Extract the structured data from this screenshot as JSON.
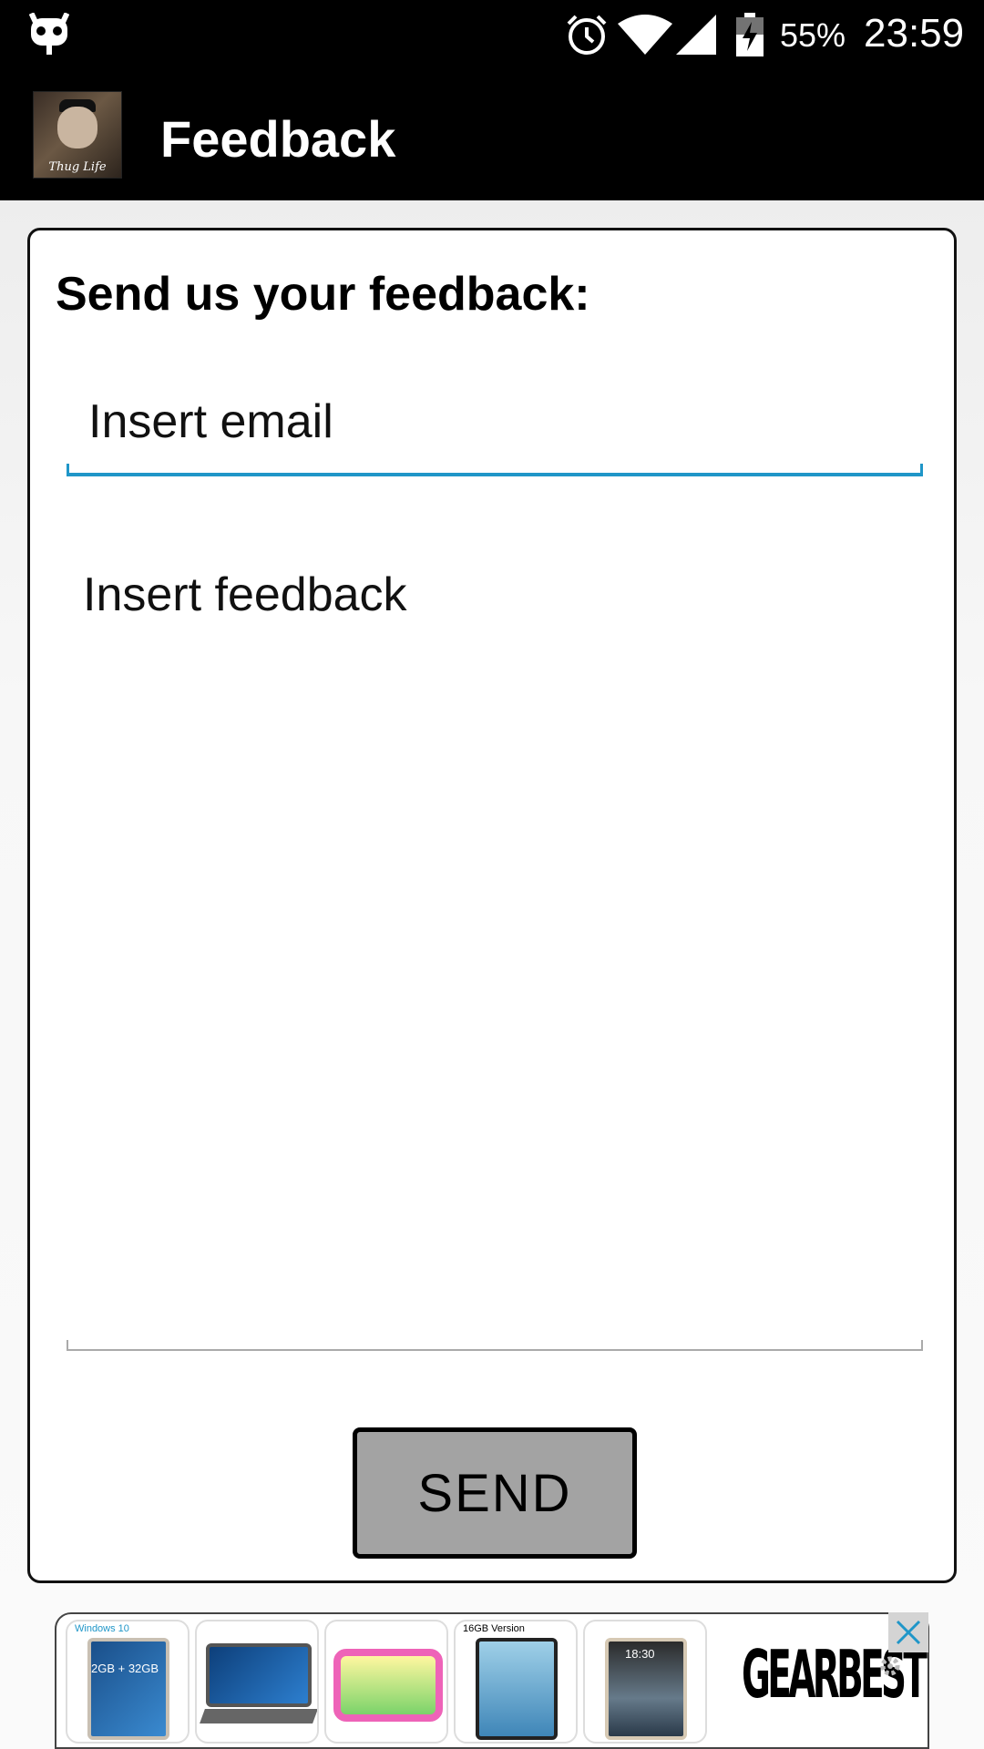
{
  "status_bar": {
    "battery_percent": "55%",
    "time": "23:59",
    "icons": [
      "cyanogen-icon",
      "alarm-icon",
      "wifi-icon",
      "signal-icon",
      "battery-charging-icon"
    ]
  },
  "app_bar": {
    "title": "Feedback",
    "logo_text": "Thug Life"
  },
  "form": {
    "heading": "Send us your feedback:",
    "email_placeholder": "Insert email",
    "email_value": "",
    "feedback_placeholder": "Insert feedback",
    "feedback_value": "",
    "send_label": "SEND",
    "accent_color": "#1f96c8"
  },
  "ad": {
    "items": [
      {
        "label": "Windows 10",
        "spec": "2GB + 32GB"
      },
      {
        "label": "",
        "spec": ""
      },
      {
        "label": "",
        "spec": ""
      },
      {
        "label": "16GB Version",
        "spec": ""
      },
      {
        "label": "",
        "spec": "18:30"
      }
    ],
    "brand": "GEARBEST"
  }
}
